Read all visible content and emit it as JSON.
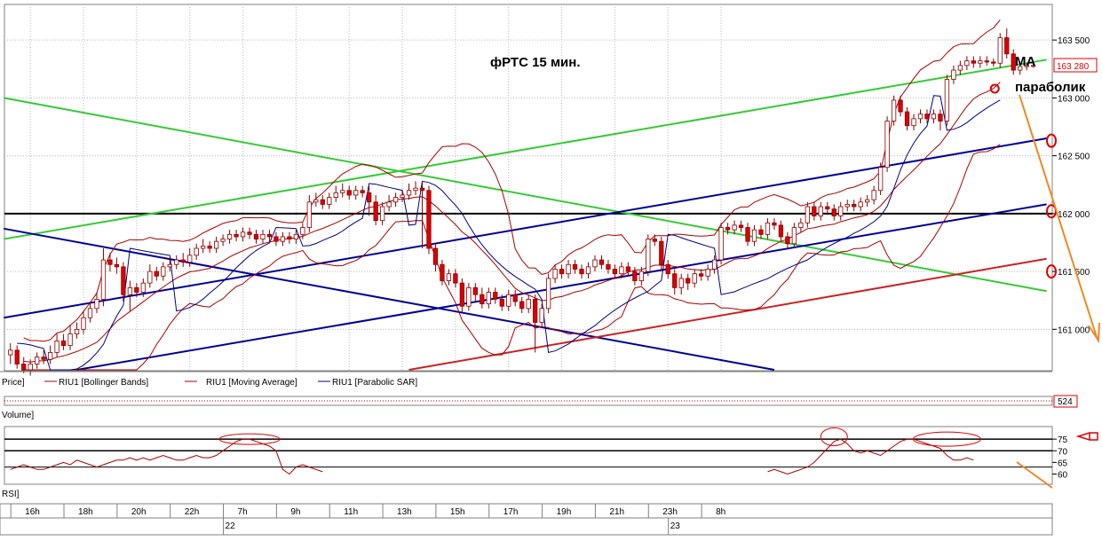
{
  "chart_data": {
    "type": "candlestick",
    "title": "фРТС   15 мин.",
    "annotations": {
      "ma": "MA",
      "parabolic": "параболик"
    },
    "price": {
      "ylim": [
        160650,
        163800
      ],
      "yticks": [
        161000,
        161500,
        162000,
        162500,
        163000,
        163500
      ],
      "ytick_labels": [
        "161 000",
        "161 500",
        "162 000",
        "162 500",
        "163 000",
        "163 500"
      ],
      "last_price_label": "163 280",
      "last_price": 163280,
      "bar_count": 150,
      "candles": [
        [
          160780,
          160820,
          160700,
          160880
        ],
        [
          160820,
          160700,
          160660,
          160860
        ],
        [
          160700,
          160650,
          160620,
          160760
        ],
        [
          160650,
          160700,
          160600,
          160740
        ],
        [
          160700,
          160760,
          160660,
          160800
        ],
        [
          160760,
          160740,
          160700,
          160820
        ],
        [
          160740,
          160800,
          160700,
          160860
        ],
        [
          160800,
          160900,
          160760,
          160960
        ],
        [
          160900,
          160860,
          160820,
          160960
        ],
        [
          160860,
          160960,
          160820,
          161040
        ],
        [
          160960,
          161000,
          160920,
          161060
        ],
        [
          161000,
          161100,
          160960,
          161160
        ],
        [
          161100,
          161180,
          161060,
          161240
        ],
        [
          161180,
          161260,
          161140,
          161320
        ],
        [
          161260,
          161600,
          161200,
          161700
        ],
        [
          161600,
          161560,
          161500,
          161660
        ],
        [
          161560,
          161540,
          161480,
          161620
        ],
        [
          161540,
          161300,
          161240,
          161580
        ],
        [
          161300,
          161360,
          161160,
          161420
        ],
        [
          161360,
          161320,
          161280,
          161400
        ],
        [
          161320,
          161400,
          161280,
          161440
        ],
        [
          161400,
          161500,
          161360,
          161560
        ],
        [
          161500,
          161460,
          161420,
          161540
        ],
        [
          161460,
          161540,
          161420,
          161580
        ],
        [
          161540,
          161560,
          161500,
          161620
        ],
        [
          161560,
          161600,
          161520,
          161640
        ],
        [
          161600,
          161580,
          161540,
          161660
        ],
        [
          161580,
          161640,
          161540,
          161700
        ],
        [
          161640,
          161700,
          161600,
          161740
        ],
        [
          161700,
          161720,
          161660,
          161780
        ],
        [
          161720,
          161700,
          161660,
          161760
        ],
        [
          161700,
          161760,
          161660,
          161800
        ],
        [
          161760,
          161780,
          161720,
          161820
        ],
        [
          161780,
          161820,
          161740,
          161860
        ],
        [
          161820,
          161800,
          161760,
          161860
        ],
        [
          161800,
          161840,
          161760,
          161880
        ],
        [
          161840,
          161820,
          161780,
          161880
        ],
        [
          161820,
          161780,
          161740,
          161860
        ],
        [
          161780,
          161820,
          161740,
          161860
        ],
        [
          161820,
          161800,
          161760,
          161860
        ],
        [
          161800,
          161760,
          161720,
          161840
        ],
        [
          161760,
          161800,
          161720,
          161840
        ],
        [
          161800,
          161780,
          161740,
          161840
        ],
        [
          161780,
          161820,
          161740,
          161860
        ],
        [
          161820,
          161880,
          161780,
          161920
        ],
        [
          161880,
          162100,
          161840,
          162160
        ],
        [
          162100,
          162120,
          162060,
          162180
        ],
        [
          162120,
          162080,
          162040,
          162160
        ],
        [
          162080,
          162140,
          162040,
          162180
        ],
        [
          162140,
          162180,
          162100,
          162240
        ],
        [
          162180,
          162200,
          162140,
          162260
        ],
        [
          162200,
          162160,
          162120,
          162240
        ],
        [
          162160,
          162200,
          162120,
          162240
        ],
        [
          162200,
          162180,
          162140,
          162240
        ],
        [
          162180,
          162100,
          161980,
          162240
        ],
        [
          162100,
          161940,
          161900,
          162160
        ],
        [
          161940,
          162060,
          161900,
          162100
        ],
        [
          162060,
          162100,
          162020,
          162160
        ],
        [
          162100,
          162140,
          162060,
          162180
        ],
        [
          162140,
          162160,
          162100,
          162200
        ],
        [
          162160,
          162200,
          162120,
          162260
        ],
        [
          162200,
          162220,
          162160,
          162280
        ],
        [
          162220,
          162200,
          161700,
          162280
        ],
        [
          162200,
          161700,
          161650,
          162240
        ],
        [
          161700,
          161560,
          161500,
          161740
        ],
        [
          161560,
          161420,
          161380,
          161600
        ],
        [
          161420,
          161480,
          161380,
          161520
        ],
        [
          161480,
          161400,
          161360,
          161520
        ],
        [
          161400,
          161200,
          161150,
          161440
        ],
        [
          161200,
          161360,
          161160,
          161400
        ],
        [
          161360,
          161300,
          161240,
          161400
        ],
        [
          161300,
          161220,
          161180,
          161360
        ],
        [
          161220,
          161320,
          161180,
          161360
        ],
        [
          161320,
          161260,
          161220,
          161360
        ],
        [
          161260,
          161200,
          161160,
          161300
        ],
        [
          161200,
          161300,
          161160,
          161340
        ],
        [
          161300,
          161240,
          161200,
          161340
        ],
        [
          161240,
          161180,
          161140,
          161280
        ],
        [
          161180,
          161260,
          161140,
          161300
        ],
        [
          161260,
          161060,
          160800,
          161300
        ],
        [
          161060,
          161180,
          161020,
          161220
        ],
        [
          161180,
          161440,
          161140,
          161480
        ],
        [
          161440,
          161520,
          161400,
          161560
        ],
        [
          161520,
          161480,
          161440,
          161560
        ],
        [
          161480,
          161560,
          161440,
          161600
        ],
        [
          161560,
          161520,
          161480,
          161600
        ],
        [
          161520,
          161480,
          161440,
          161560
        ],
        [
          161480,
          161540,
          161440,
          161580
        ],
        [
          161540,
          161600,
          161500,
          161640
        ],
        [
          161600,
          161560,
          161520,
          161640
        ],
        [
          161560,
          161520,
          161480,
          161600
        ],
        [
          161520,
          161480,
          161440,
          161560
        ],
        [
          161480,
          161540,
          161440,
          161580
        ],
        [
          161540,
          161500,
          161460,
          161580
        ],
        [
          161500,
          161420,
          161380,
          161540
        ],
        [
          161420,
          161500,
          161380,
          161540
        ],
        [
          161500,
          161780,
          161460,
          161820
        ],
        [
          161780,
          161760,
          161720,
          161820
        ],
        [
          161760,
          161560,
          161500,
          161800
        ],
        [
          161560,
          161480,
          161440,
          161600
        ],
        [
          161480,
          161360,
          161300,
          161520
        ],
        [
          161360,
          161440,
          161300,
          161480
        ],
        [
          161440,
          161400,
          161340,
          161480
        ],
        [
          161400,
          161480,
          161360,
          161520
        ],
        [
          161480,
          161460,
          161420,
          161520
        ],
        [
          161460,
          161520,
          161420,
          161560
        ],
        [
          161520,
          161600,
          161480,
          161640
        ],
        [
          161600,
          161880,
          161560,
          161920
        ],
        [
          161880,
          161860,
          161820,
          161920
        ],
        [
          161860,
          161900,
          161820,
          161940
        ],
        [
          161900,
          161880,
          161840,
          161940
        ],
        [
          161880,
          161760,
          161720,
          161920
        ],
        [
          161760,
          161860,
          161720,
          161900
        ],
        [
          161860,
          161820,
          161780,
          161900
        ],
        [
          161820,
          161920,
          161780,
          161960
        ],
        [
          161920,
          161900,
          161860,
          161960
        ],
        [
          161900,
          161800,
          161760,
          161940
        ],
        [
          161800,
          161740,
          161700,
          161840
        ],
        [
          161740,
          161880,
          161700,
          161920
        ],
        [
          161880,
          161920,
          161840,
          161960
        ],
        [
          161920,
          162060,
          161880,
          162100
        ],
        [
          162060,
          161980,
          161940,
          162100
        ],
        [
          161980,
          162060,
          161940,
          162100
        ],
        [
          162060,
          162040,
          162000,
          162100
        ],
        [
          162040,
          161980,
          161940,
          162080
        ],
        [
          161980,
          162060,
          161940,
          162100
        ],
        [
          162060,
          162080,
          162020,
          162120
        ],
        [
          162080,
          162060,
          162020,
          162120
        ],
        [
          162060,
          162100,
          162020,
          162140
        ],
        [
          162100,
          162120,
          162060,
          162160
        ],
        [
          162120,
          162200,
          162080,
          162240
        ],
        [
          162200,
          162400,
          162160,
          162440
        ],
        [
          162400,
          162800,
          162360,
          162840
        ],
        [
          162800,
          162980,
          162760,
          163020
        ],
        [
          162980,
          162880,
          162840,
          163020
        ],
        [
          162880,
          162760,
          162720,
          162920
        ],
        [
          162760,
          162820,
          162720,
          162860
        ],
        [
          162820,
          162860,
          162780,
          162900
        ],
        [
          162860,
          162820,
          162780,
          162900
        ],
        [
          162820,
          162860,
          162780,
          162900
        ],
        [
          162860,
          162800,
          162720,
          162900
        ],
        [
          162800,
          163160,
          162760,
          163200
        ],
        [
          163160,
          163240,
          163120,
          163280
        ],
        [
          163240,
          163280,
          163200,
          163320
        ],
        [
          163280,
          163320,
          163240,
          163360
        ],
        [
          163320,
          163300,
          163260,
          163360
        ],
        [
          163300,
          163320,
          163260,
          163360
        ],
        [
          163320,
          163310,
          163280,
          163360
        ],
        [
          163310,
          163300,
          163270,
          163340
        ],
        [
          163300,
          163520,
          163260,
          163560
        ],
        [
          163520,
          163380,
          163340,
          163600
        ],
        [
          163380,
          163240,
          163200,
          163420
        ],
        [
          163240,
          163270,
          163200,
          163300
        ],
        [
          163270,
          163280,
          163240,
          163300
        ],
        [
          163280,
          163280,
          163260,
          163300
        ]
      ]
    },
    "legend": {
      "price": "Price]",
      "bollinger": "RIU1 [Bollinger Bands]",
      "moving_average": "RIU1 [Moving Average]",
      "parabolic_sar": "RIU1 [Parabolic SAR]"
    },
    "volume": {
      "label": "Volume]",
      "last_value": "524"
    },
    "rsi": {
      "label": "RSI]",
      "ylim": [
        56,
        80
      ],
      "yticks": [
        60,
        65,
        70,
        75
      ],
      "values": [
        62,
        63,
        64,
        63,
        62,
        62,
        63,
        64,
        65,
        64,
        66,
        65,
        64,
        63,
        64,
        65,
        66,
        66,
        67,
        66,
        67,
        66,
        67,
        68,
        67,
        66,
        66,
        67,
        68,
        67,
        67,
        68,
        70,
        72,
        74,
        75,
        75,
        74,
        73,
        72,
        70,
        62,
        60,
        63,
        64,
        63,
        62,
        61,
        null,
        null,
        null,
        null,
        null,
        null,
        null,
        null,
        null,
        null,
        null,
        null,
        null,
        null,
        null,
        null,
        null,
        null,
        null,
        null,
        null,
        null,
        null,
        null,
        null,
        null,
        null,
        null,
        null,
        null,
        null,
        null,
        null,
        null,
        null,
        null,
        null,
        null,
        null,
        null,
        null,
        null,
        null,
        null,
        null,
        null,
        null,
        null,
        null,
        null,
        null,
        null,
        null,
        null,
        null,
        null,
        null,
        null,
        null,
        null,
        null,
        null,
        null,
        null,
        null,
        null,
        61,
        62,
        61,
        60,
        61,
        62,
        63,
        65,
        68,
        71,
        74,
        75,
        73,
        70,
        69,
        70,
        69,
        68,
        70,
        72,
        74,
        75,
        75,
        74,
        73,
        72,
        71,
        68,
        66,
        66,
        67,
        66,
        null,
        null,
        null,
        null
      ]
    },
    "time_axis": {
      "ticks": [
        {
          "label": "16h",
          "bar": 3
        },
        {
          "label": "18h",
          "bar": 11
        },
        {
          "label": "20h",
          "bar": 19
        },
        {
          "label": "22h",
          "bar": 27
        },
        {
          "label": "7h",
          "bar": 35
        },
        {
          "label": "9h",
          "bar": 43
        },
        {
          "label": "11h",
          "bar": 51
        },
        {
          "label": "13h",
          "bar": 59
        },
        {
          "label": "15h",
          "bar": 67
        },
        {
          "label": "17h",
          "bar": 75
        },
        {
          "label": "19h",
          "bar": 83
        },
        {
          "label": "21h",
          "bar": 91
        },
        {
          "label": "23h",
          "bar": 99
        },
        {
          "label": "8h",
          "bar": 107
        }
      ],
      "day_labels": [
        {
          "label": "22",
          "bar": 35
        },
        {
          "label": "23",
          "bar": 102
        }
      ]
    },
    "colors": {
      "bull": "#ffffff",
      "bear": "#dd0000",
      "wick": "#880000",
      "bollinger": "#aa0000",
      "moving_average": "#aa0000",
      "parabolic_sar": "#000088",
      "green_line": "#33cc33",
      "blue_line": "#000099",
      "red_line": "#cc2222",
      "horizontal_level": "#000000",
      "forecast_arrow": "#ee8822",
      "circle": "#dd0000"
    }
  }
}
